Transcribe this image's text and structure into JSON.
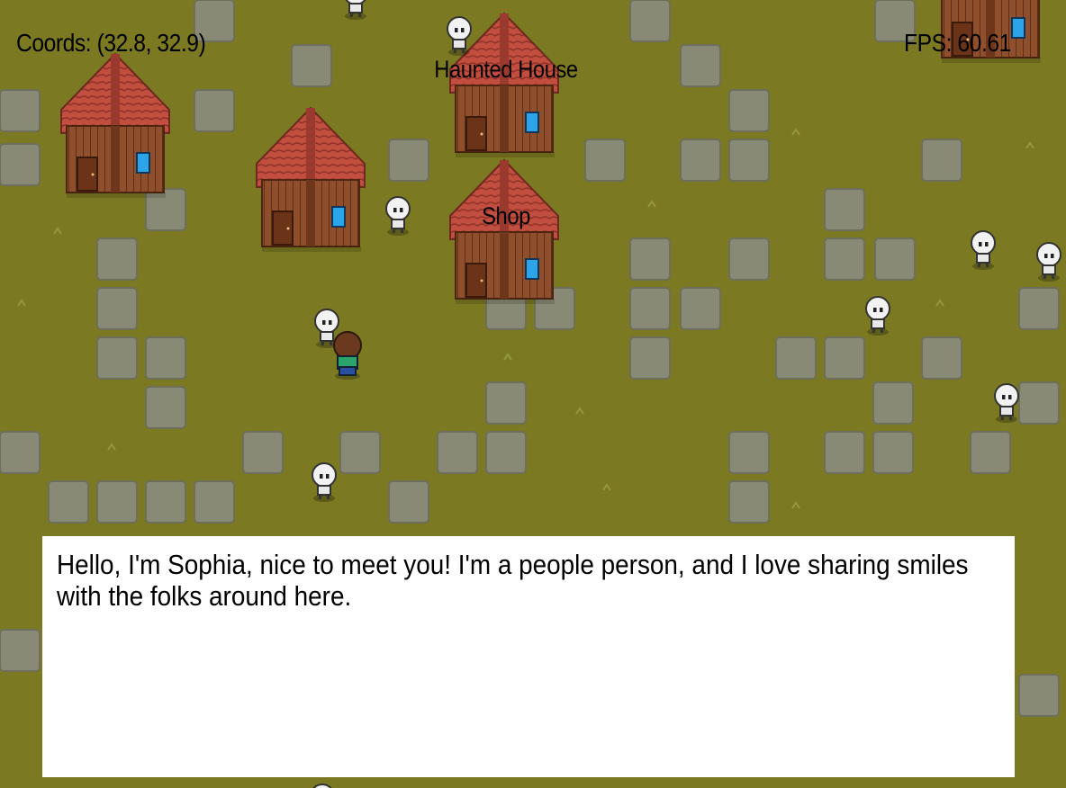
{
  "hud": {
    "coords": "Coords: (32.8, 32.9)",
    "fps": "FPS: 60.61"
  },
  "buildings": [
    {
      "name": "haunted-house",
      "label": "Haunted House"
    },
    {
      "name": "shop",
      "label": "Shop"
    }
  ],
  "dialog": {
    "text": "Hello, I'm Sophia, nice to meet you! I'm a people person, and I love sharing smiles with the folks around here."
  },
  "colors": {
    "grass": "#7b7a22",
    "stone": "#8a8a7a",
    "roof": "#b8483a",
    "wall": "#8a4a2a",
    "window": "#2a9fe0",
    "dialog_bg": "#ffffff"
  }
}
